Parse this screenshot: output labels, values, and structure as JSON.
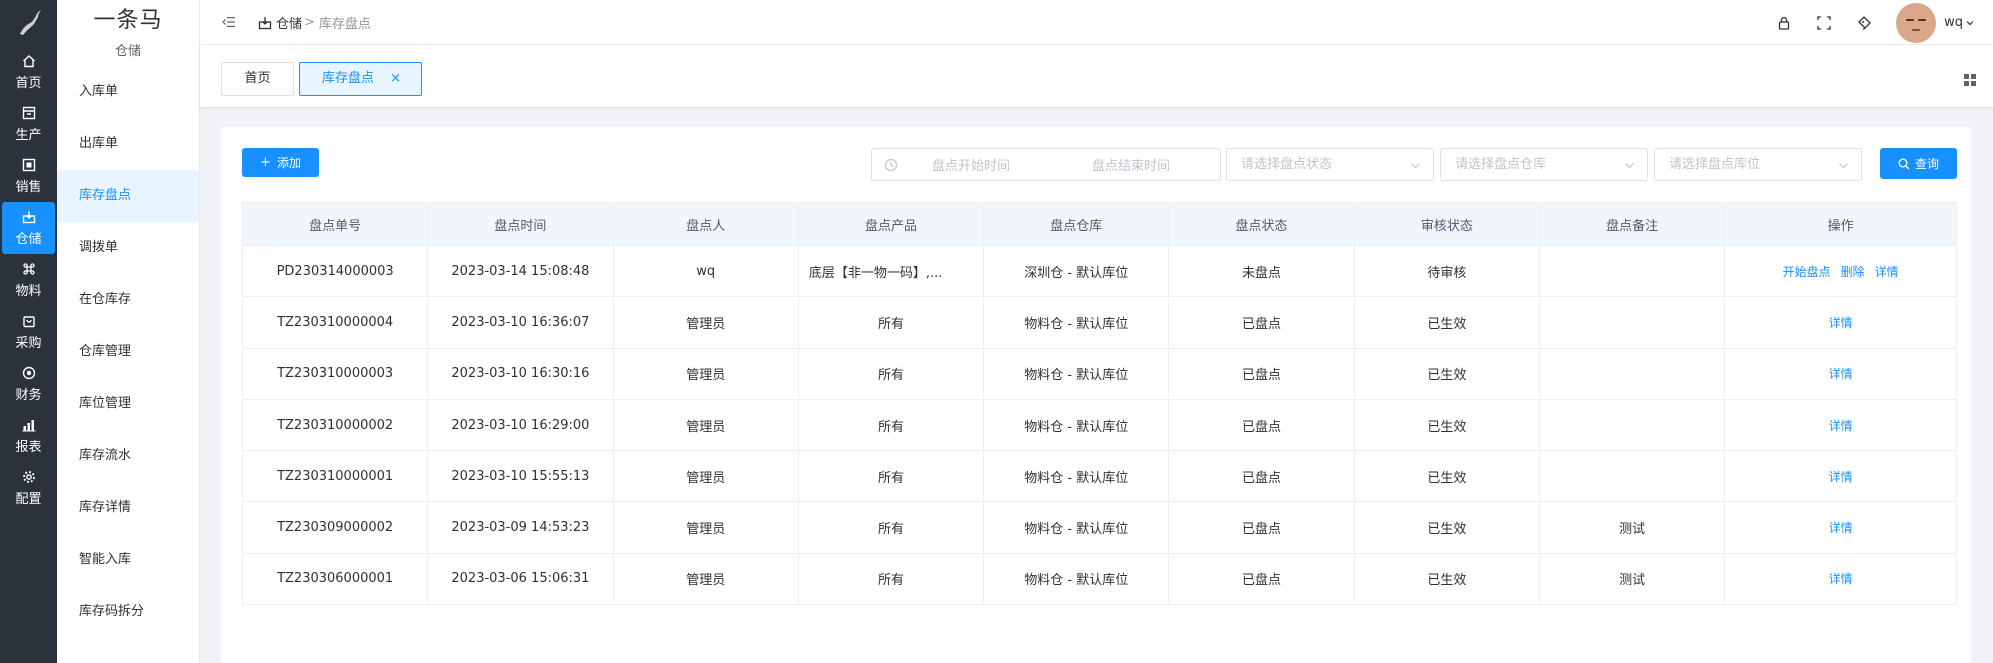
{
  "rail": {
    "items": [
      {
        "label": "首页",
        "icon": "home-icon"
      },
      {
        "label": "生产",
        "icon": "factory-icon"
      },
      {
        "label": "销售",
        "icon": "sales-icon"
      },
      {
        "label": "仓储",
        "icon": "warehouse-icon",
        "active": true
      },
      {
        "label": "物料",
        "icon": "command-icon"
      },
      {
        "label": "采购",
        "icon": "purchase-bag-icon"
      },
      {
        "label": "财务",
        "icon": "finance-target-icon"
      },
      {
        "label": "报表",
        "icon": "bar-chart-icon"
      },
      {
        "label": "配置",
        "icon": "gear-icon"
      }
    ]
  },
  "brand": {
    "name": "一条马",
    "sub": "仓储"
  },
  "submenu": {
    "items": [
      "入库单",
      "出库单",
      "库存盘点",
      "调拨单",
      "在仓库存",
      "仓库管理",
      "库位管理",
      "库存流水",
      "库存详情",
      "智能入库",
      "库存码拆分"
    ],
    "active_index": 2
  },
  "breadcrumb": {
    "c1": "仓储",
    "sep": ">",
    "c2": "库存盘点"
  },
  "user": {
    "name": "wq"
  },
  "tags": {
    "home": "首页",
    "active": "库存盘点",
    "close": "×"
  },
  "toolbar": {
    "add_label": "添加",
    "add_plus": "+",
    "start_placeholder": "盘点开始时间",
    "end_placeholder": "盘点结束时间",
    "status_placeholder": "请选择盘点状态",
    "warehouse_placeholder": "请选择盘点仓库",
    "location_placeholder": "请选择盘点库位",
    "query_label": "查询"
  },
  "table": {
    "columns": [
      "盘点单号",
      "盘点时间",
      "盘点人",
      "盘点产品",
      "盘点仓库",
      "盘点状态",
      "审核状态",
      "盘点备注",
      "操作"
    ],
    "rows": [
      {
        "no": "PD230314000003",
        "time": "2023-03-14 15:08:48",
        "person": "wq",
        "product": "底层【非一物一码】,...",
        "warehouse": "深圳仓 - 默认库位",
        "status": "未盘点",
        "audit": "待审核",
        "remark": "",
        "ops": [
          "开始盘点",
          "删除",
          "详情"
        ]
      },
      {
        "no": "TZ230310000004",
        "time": "2023-03-10 16:36:07",
        "person": "管理员",
        "product": "所有",
        "warehouse": "物料仓 - 默认库位",
        "status": "已盘点",
        "audit": "已生效",
        "remark": "",
        "ops": [
          "详情"
        ]
      },
      {
        "no": "TZ230310000003",
        "time": "2023-03-10 16:30:16",
        "person": "管理员",
        "product": "所有",
        "warehouse": "物料仓 - 默认库位",
        "status": "已盘点",
        "audit": "已生效",
        "remark": "",
        "ops": [
          "详情"
        ]
      },
      {
        "no": "TZ230310000002",
        "time": "2023-03-10 16:29:00",
        "person": "管理员",
        "product": "所有",
        "warehouse": "物料仓 - 默认库位",
        "status": "已盘点",
        "audit": "已生效",
        "remark": "",
        "ops": [
          "详情"
        ]
      },
      {
        "no": "TZ230310000001",
        "time": "2023-03-10 15:55:13",
        "person": "管理员",
        "product": "所有",
        "warehouse": "物料仓 - 默认库位",
        "status": "已盘点",
        "audit": "已生效",
        "remark": "",
        "ops": [
          "详情"
        ]
      },
      {
        "no": "TZ230309000002",
        "time": "2023-03-09 14:53:23",
        "person": "管理员",
        "product": "所有",
        "warehouse": "物料仓 - 默认库位",
        "status": "已盘点",
        "audit": "已生效",
        "remark": "测试",
        "ops": [
          "详情"
        ]
      },
      {
        "no": "TZ230306000001",
        "time": "2023-03-06 15:06:31",
        "person": "管理员",
        "product": "所有",
        "warehouse": "物料仓 - 默认库位",
        "status": "已盘点",
        "audit": "已生效",
        "remark": "测试",
        "ops": [
          "详情"
        ]
      }
    ]
  },
  "colors": {
    "accent": "#1890ff",
    "rail_bg": "#2b323c",
    "active_bg": "#e8f4ff",
    "header_bg": "#f2f5f9"
  }
}
